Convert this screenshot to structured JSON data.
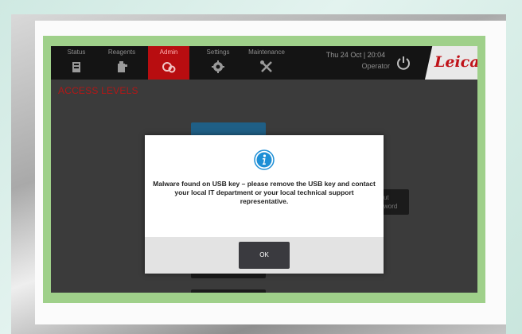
{
  "topbar": {
    "tabs": [
      {
        "label": "Status",
        "icon": "status-icon"
      },
      {
        "label": "Reagents",
        "icon": "reagent-bottle-icon"
      },
      {
        "label": "Admin",
        "icon": "admin-icon"
      },
      {
        "label": "Settings",
        "icon": "gear-icon"
      },
      {
        "label": "Maintenance",
        "icon": "tools-icon"
      }
    ],
    "active_tab": "Admin",
    "datetime": "Thu 24 Oct | 20:04",
    "user": "Operator",
    "logo": "Leica"
  },
  "page": {
    "title": "ACCESS LEVELS",
    "partial_button_text": [
      "ut",
      "word"
    ]
  },
  "dialog": {
    "icon": "info-icon",
    "message": "Malware found on USB key – please remove the USB key and contact your local IT department or your local technical support representative.",
    "ok_label": "OK"
  },
  "colors": {
    "accent_red": "#b80d10",
    "info_blue": "#1e8fd6",
    "frame_green": "#9fd08a",
    "ok_button": "#3a3a3f"
  }
}
